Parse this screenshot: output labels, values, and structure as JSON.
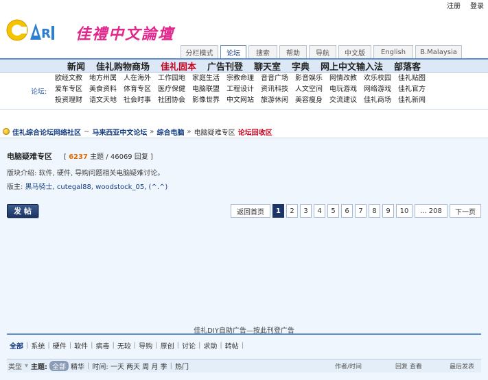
{
  "top_links": {
    "register": "注册",
    "login": "登录"
  },
  "site": {
    "title": "佳禮中文論壇"
  },
  "tabs": [
    "分栏模式",
    "论坛",
    "搜索",
    "帮助",
    "导航",
    "中文版",
    "English",
    "B.Malaysia"
  ],
  "active_tab": 1,
  "nav": [
    "新闻",
    "佳礼购物商场",
    "佳礼固本",
    "广告刊登",
    "聊天室",
    "字典",
    "网上中文输入法",
    "部落客"
  ],
  "nav_hot_index": 2,
  "forum_label": "论坛:",
  "forum_links": [
    "欧经文教",
    "地方州属",
    "人在海外",
    "工作园地",
    "家庭生活",
    "宗教命理",
    "音音广场",
    "影音娱乐",
    "网情改教",
    "欢乐校园",
    "佳礼贴图",
    "爱车专区",
    "美食资料",
    "体育专区",
    "医疗保健",
    "电脑联盟",
    "工程设计",
    "资讯科技",
    "人文空间",
    "电玩游戏",
    "网络游戏",
    "佳礼官方",
    "投资理财",
    "语文天地",
    "社会时事",
    "社团协会",
    "影像世界",
    "中文网站",
    "旅游休闲",
    "美容瘦身",
    "交流建议",
    "佳礼商场",
    "佳礼新闻"
  ],
  "breadcrumb": {
    "home": "佳礼综合论坛网络社区",
    "site": "马来西亚中文论坛",
    "cat": "综合电脑",
    "sub": "电脑疑难专区",
    "current": "论坛回收区"
  },
  "forum": {
    "title": "电脑疑难专区",
    "threads": "6237",
    "threads_label": "主题",
    "replies": "46069",
    "replies_label": "回复",
    "intro": "版块介绍: 软件, 硬件, 导购问题相关电脑疑难讨论。",
    "mods_label": "版主:",
    "mods": "黑马骑士, cutegal88, woodstock_05, (^.^)"
  },
  "post_button": "发 帖",
  "pager": {
    "back": "返回首页",
    "pages": [
      "1",
      "2",
      "3",
      "4",
      "5",
      "6",
      "7",
      "8",
      "9",
      "10"
    ],
    "last": "... 208",
    "next": "下一页"
  },
  "ad_text": "佳礼DIY自助广告—按此刊登广告",
  "filters": [
    "全部",
    "系统",
    "硬件",
    "软件",
    "病毒",
    "无较",
    "导购",
    "原创",
    "讨论",
    "求助",
    "转帖"
  ],
  "thead": {
    "type": "类型",
    "subject": "主题:",
    "all": "全部",
    "digest": "精华",
    "time": "时间: 一天 两天 周 月 季",
    "hot": "热门",
    "author": "作者/时间",
    "replies": "回复 查看",
    "lastpost": "最后发表"
  }
}
